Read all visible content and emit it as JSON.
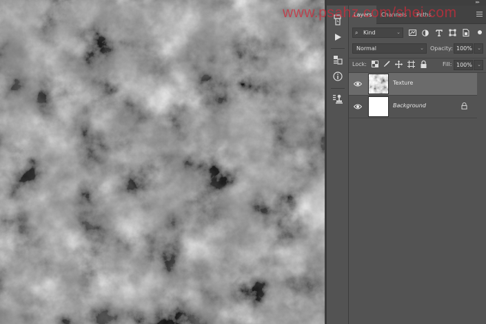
{
  "watermark": "www.psahz.com/shei.com",
  "panel": {
    "tabs": [
      {
        "label": "Layers",
        "active": true
      },
      {
        "label": "Channels",
        "active": false
      },
      {
        "label": "Paths",
        "active": false
      }
    ],
    "filter": {
      "kind_label": "Kind",
      "icons": [
        "pixel-filter-icon",
        "adjustment-filter-icon",
        "type-filter-icon",
        "shape-filter-icon",
        "smart-object-filter-icon"
      ]
    },
    "blend_mode": "Normal",
    "opacity_label": "Opacity:",
    "opacity_value": "100%",
    "lock_label": "Lock:",
    "fill_label": "Fill:",
    "fill_value": "100%",
    "layers": [
      {
        "name": "Texture",
        "visible": true,
        "selected": true,
        "locked": false
      },
      {
        "name": "Background",
        "visible": true,
        "selected": false,
        "locked": true
      }
    ]
  },
  "toolstrip": {
    "items": [
      "history-icon",
      "play-action-icon",
      "properties-icon",
      "info-icon",
      "clone-source-icon"
    ]
  },
  "colors": {
    "panel_bg": "#535353",
    "selected_layer": "#6b6b6b",
    "watermark": "#d02b3b"
  }
}
